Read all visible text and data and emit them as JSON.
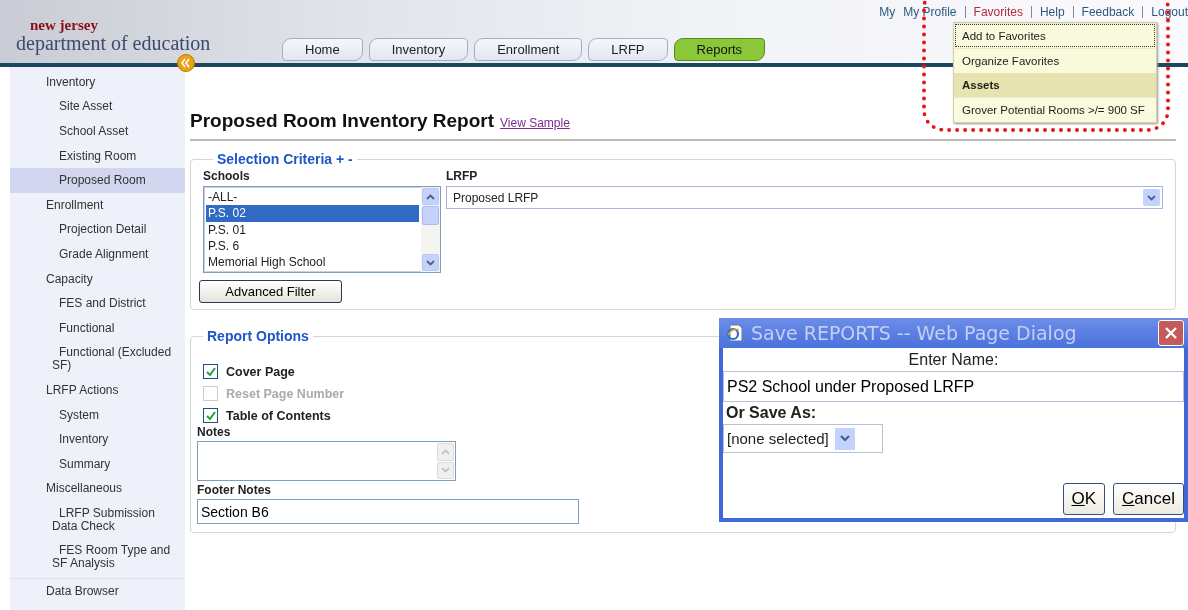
{
  "header": {
    "logo_top": "new jersey",
    "logo_bottom": "department of education",
    "links": [
      {
        "label": "My",
        "selected": false
      },
      {
        "label": "My Profile",
        "selected": false
      },
      {
        "label": "Favorites",
        "selected": true
      },
      {
        "label": "Help",
        "selected": false
      },
      {
        "label": "Feedback",
        "selected": false
      },
      {
        "label": "Logout",
        "selected": false
      }
    ]
  },
  "tabs": [
    {
      "label": "Home",
      "selected": false
    },
    {
      "label": "Inventory",
      "selected": false
    },
    {
      "label": "Enrollment",
      "selected": false
    },
    {
      "label": "LRFP",
      "selected": false
    },
    {
      "label": "Reports",
      "selected": true
    }
  ],
  "favorites_menu": {
    "items": [
      {
        "kind": "item",
        "label": "Add to Favorites",
        "selected": true
      },
      {
        "kind": "item",
        "label": "Organize Favorites",
        "selected": false
      },
      {
        "kind": "header",
        "label": "Assets"
      },
      {
        "kind": "item",
        "label": "Grover Potential Rooms >/= 900 SF",
        "selected": false
      }
    ]
  },
  "sidebar": {
    "items": [
      {
        "label": "Inventory",
        "selected": false,
        "children": [
          {
            "label": "Site Asset",
            "selected": false
          },
          {
            "label": "School Asset",
            "selected": false
          },
          {
            "label": "Existing Room",
            "selected": false
          },
          {
            "label": "Proposed Room",
            "selected": true
          }
        ]
      },
      {
        "label": "Enrollment",
        "selected": false,
        "children": [
          {
            "label": "Projection Detail",
            "selected": false
          },
          {
            "label": "Grade Alignment",
            "selected": false
          }
        ]
      },
      {
        "label": "Capacity",
        "selected": false,
        "children": [
          {
            "label": "FES and District",
            "selected": false
          },
          {
            "label": "Functional",
            "selected": false
          },
          {
            "label": "Functional (Excluded SF)",
            "selected": false
          }
        ]
      },
      {
        "label": "LRFP Actions",
        "selected": false,
        "children": [
          {
            "label": "System",
            "selected": false
          },
          {
            "label": "Inventory",
            "selected": false
          },
          {
            "label": "Summary",
            "selected": false
          }
        ]
      },
      {
        "label": "Miscellaneous",
        "selected": false,
        "children": [
          {
            "label": "LRFP Submission Data Check",
            "selected": false
          },
          {
            "label": "FES Room Type and SF Analysis",
            "selected": false
          }
        ]
      }
    ],
    "footer_item": "Data Browser"
  },
  "page": {
    "title": "Proposed Room Inventory Report",
    "sample_link": "View Sample"
  },
  "selection_criteria": {
    "legend": "Selection Criteria + -",
    "schools_label": "Schools",
    "schools": [
      {
        "label": "-ALL-",
        "selected": false
      },
      {
        "label": "P.S. 02",
        "selected": true
      },
      {
        "label": "P.S. 01",
        "selected": false
      },
      {
        "label": "P.S. 6",
        "selected": false
      },
      {
        "label": "Memorial High School",
        "selected": false
      }
    ],
    "lrfp_label": "LRFP",
    "lrfp_value": "Proposed LRFP",
    "advanced_filter": "Advanced Filter"
  },
  "report_options": {
    "legend": "Report Options",
    "options": [
      {
        "label": "Cover Page",
        "checked": true,
        "disabled": false
      },
      {
        "label": "Reset Page Number",
        "checked": false,
        "disabled": true
      },
      {
        "label": "Table of Contents",
        "checked": true,
        "disabled": false
      }
    ],
    "notes_label": "Notes",
    "footer_label": "Footer Notes",
    "footer_value": "Section B6"
  },
  "dialog": {
    "title": "Save REPORTS -- Web Page Dialog",
    "prompt": "Enter Name:",
    "name_value": "PS2 School under Proposed LRFP",
    "save_as_label": "Or Save As:",
    "save_as_value": "[none selected]",
    "buttons": [
      "OK",
      "Cancel"
    ]
  }
}
